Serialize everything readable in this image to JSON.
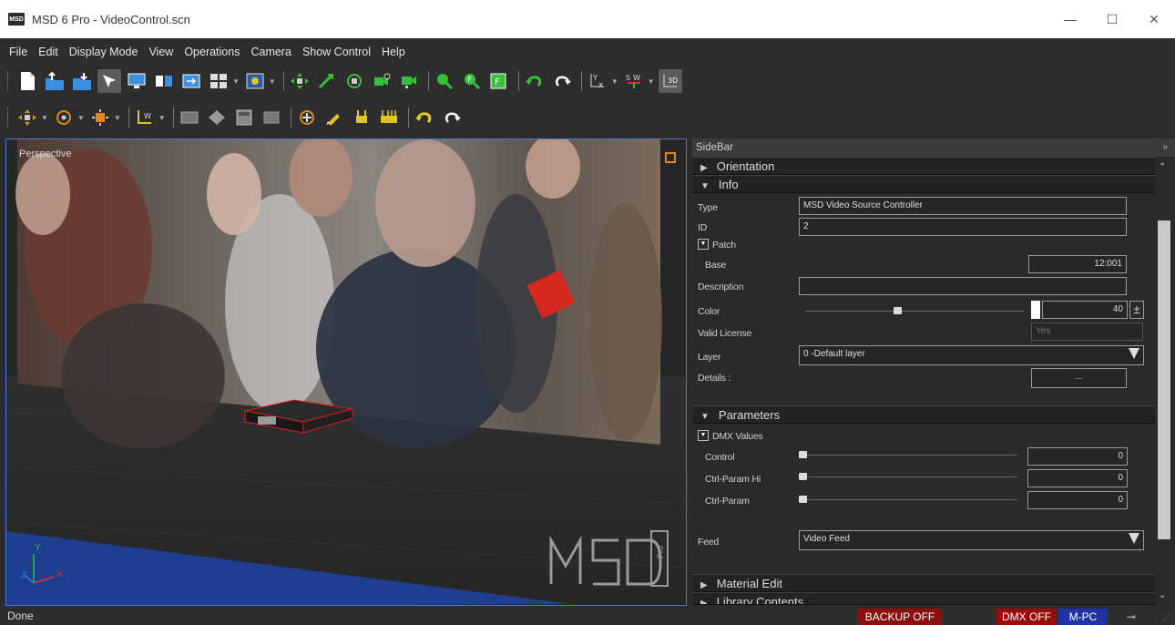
{
  "window": {
    "title": "MSD 6 Pro - VideoControl.scn",
    "icon_text": "MSD",
    "minimize": "—",
    "maximize": "☐",
    "close": "✕"
  },
  "menu": [
    "File",
    "Edit",
    "Display Mode",
    "View",
    "Operations",
    "Camera",
    "Show Control",
    "Help"
  ],
  "viewport": {
    "label": "Perspective",
    "axis_y": "Y",
    "axis_x": "X",
    "axis_z": "Z",
    "logo_text": "MSD",
    "logo_sub": "Pro"
  },
  "sidebar": {
    "title": "SideBar",
    "collapse_icon": "»",
    "sections": {
      "orientation": "Orientation",
      "info": "Info",
      "parameters": "Parameters",
      "material_edit": "Material Edit",
      "library_contents": "Library Contents"
    },
    "info": {
      "type_label": "Type",
      "type_value": "MSD Video Source Controller",
      "id_label": "ID",
      "id_value": "2",
      "patch_label": "Patch",
      "base_label": "Base",
      "base_value": "12:001",
      "description_label": "Description",
      "description_value": "",
      "color_label": "Color",
      "color_value": "40",
      "color_level": 0.42,
      "spin_symbol": "±",
      "license_label": "Valid License",
      "license_value": "Yes",
      "layer_label": "Layer",
      "layer_value": "0 -Default layer",
      "details_label": "Details :",
      "details_value": "..."
    },
    "parameters": {
      "dmx_label": "DMX Values",
      "rows": [
        {
          "label": "Control",
          "value": "0",
          "level": 0
        },
        {
          "label": "Ctrl-Param Hi",
          "value": "0",
          "level": 0
        },
        {
          "label": "Ctrl-Param",
          "value": "0",
          "level": 0
        }
      ],
      "feed_label": "Feed",
      "feed_value": "Video Feed"
    }
  },
  "status": {
    "text": "Done",
    "backup": "BACKUP OFF",
    "dmx": "DMX OFF",
    "mpc": "M-PC",
    "plug": "⊸",
    "colors": {
      "backup": "#8b0f0f",
      "dmx": "#9a0c0c",
      "mpc": "#1f33a8"
    }
  }
}
